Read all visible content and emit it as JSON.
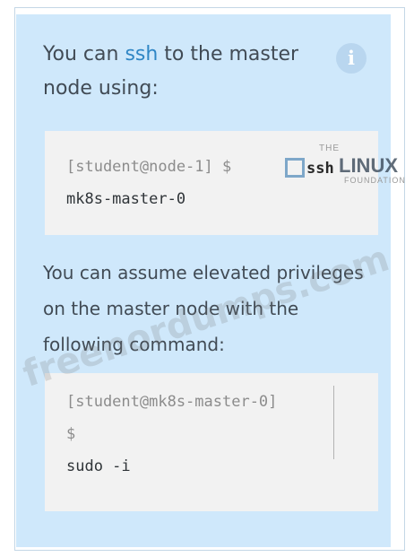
{
  "info_card": {
    "intro_prefix": "You can ",
    "intro_keyword": "ssh",
    "intro_suffix": " to the master node using:",
    "info_icon_glyph": "i",
    "info_icon_name": "info-icon",
    "ssh_block": {
      "prompt": "[student@node-1] $",
      "command_line_1": "ssh",
      "command_line_2": "mk8s-master-0"
    },
    "elevate_text": "You can assume elevated privileges on the master node with the following command:",
    "sudo_block": {
      "prompt_line_1": "[student@mk8s-master-0]",
      "prompt_line_2": "$",
      "command": "sudo -i"
    }
  },
  "watermarks": {
    "logo_the": "THE",
    "logo_linux": "LINUX",
    "logo_foundation": "FOUNDATION",
    "site": "freenordumps.com"
  },
  "colors": {
    "panel_bg": "#cfe8fb",
    "keyword": "#2f86c5",
    "code_bg": "#f2f2f2"
  }
}
